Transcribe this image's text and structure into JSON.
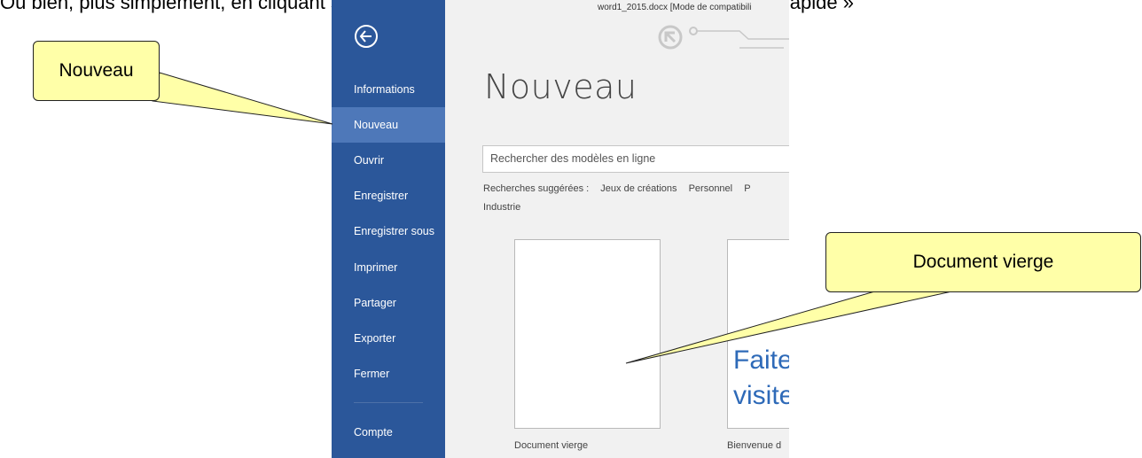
{
  "top_text": {
    "before": "Ou bien, plus simplement, en cliquant sur l'icône",
    "after": "si vous l'avez ajoutée à votre « accès rapide »"
  },
  "window": {
    "title": "word1_2015.docx [Mode de compatibili"
  },
  "sidebar": {
    "items": [
      {
        "label": "Informations"
      },
      {
        "label": "Nouveau"
      },
      {
        "label": "Ouvrir"
      },
      {
        "label": "Enregistrer"
      },
      {
        "label": "Enregistrer sous"
      },
      {
        "label": "Imprimer"
      },
      {
        "label": "Partager"
      },
      {
        "label": "Exporter"
      },
      {
        "label": "Fermer"
      },
      {
        "label": "Compte"
      }
    ],
    "active": "Nouveau"
  },
  "main": {
    "title": "Nouveau",
    "search_placeholder": "Rechercher des modèles en ligne",
    "suggested_label": "Recherches suggérées :",
    "suggested": [
      "Jeux de créations",
      "Personnel",
      "P",
      "Industrie"
    ],
    "templates": [
      {
        "label": "Document vierge"
      },
      {
        "label": "Bienvenue d",
        "thumb_line1": "Faite",
        "thumb_line2": "visite"
      }
    ]
  },
  "callouts": {
    "nouveau": "Nouveau",
    "document_vierge": "Document vierge"
  },
  "colors": {
    "sidebar": "#2b579a",
    "sidebar_active": "#4e78b9",
    "background": "#f1f1f1",
    "callout": "#ffffa8",
    "accent_text": "#2e6ab8"
  },
  "icons": {
    "back": "back-arrow-icon"
  }
}
